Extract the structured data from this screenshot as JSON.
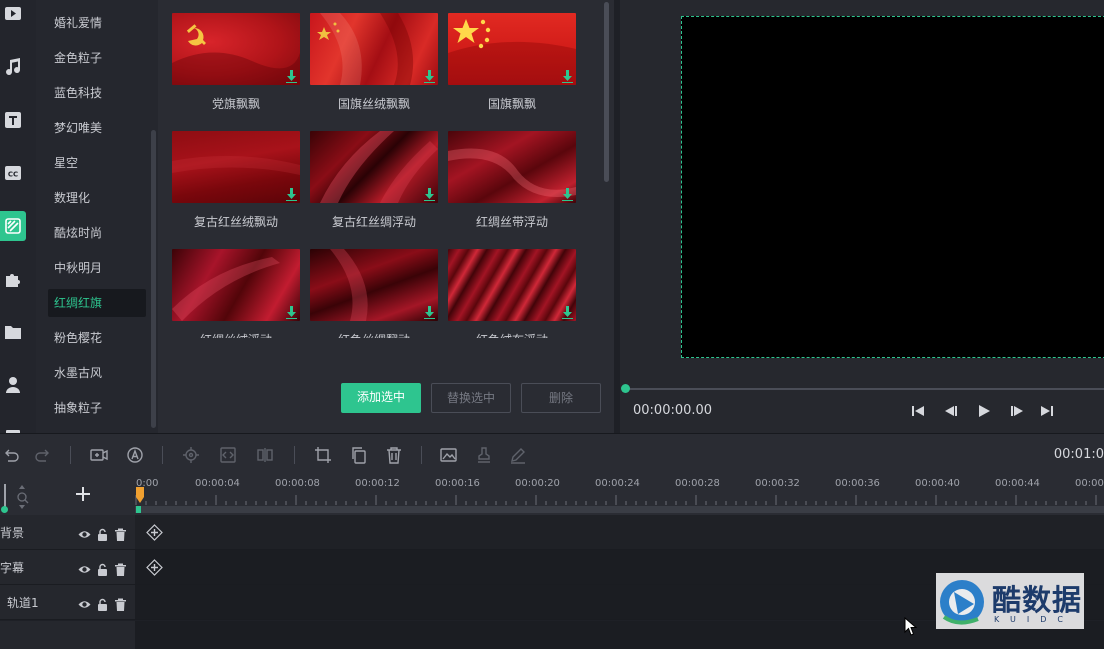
{
  "sidebar": {
    "icons": [
      "media-icon",
      "music-icon",
      "text-icon",
      "subtitle-icon",
      "effects-icon",
      "plugin-icon",
      "folder-icon",
      "person-icon",
      "more-icon"
    ],
    "active_icon": "effects-icon"
  },
  "categories": {
    "items": [
      "婚礼爱情",
      "金色粒子",
      "蓝色科技",
      "梦幻唯美",
      "星空",
      "数理化",
      "酷炫时尚",
      "中秋明月",
      "红绸红旗",
      "粉色樱花",
      "水墨古风",
      "抽象粒子"
    ],
    "selected": "红绸红旗"
  },
  "resources": {
    "items": [
      {
        "label": "党旗飘飘",
        "download_icon": "download-icon"
      },
      {
        "label": "国旗丝绒飘飘",
        "download_icon": "download-icon"
      },
      {
        "label": "国旗飘飘",
        "download_icon": "download-icon"
      },
      {
        "label": "复古红丝绒飘动",
        "download_icon": "download-icon"
      },
      {
        "label": "复古红丝绸浮动",
        "download_icon": "download-icon"
      },
      {
        "label": "红绸丝带浮动",
        "download_icon": "download-icon"
      },
      {
        "label": "红绸丝绒浮动",
        "download_icon": "download-icon"
      },
      {
        "label": "红色丝绸翻动",
        "download_icon": "download-icon"
      },
      {
        "label": "红色绒布浮动",
        "download_icon": "download-icon"
      }
    ],
    "buttons": {
      "add": "添加选中",
      "replace": "替换选中",
      "delete": "删除"
    }
  },
  "preview": {
    "timecode": "00:00:00.00",
    "controls": [
      "skip-start-icon",
      "step-back-icon",
      "play-icon",
      "step-forward-icon",
      "skip-end-icon"
    ]
  },
  "toolbar": {
    "icons": [
      "undo-icon",
      "redo-icon",
      "record-icon",
      "auto-icon",
      "locate-icon",
      "split-icon",
      "mirror-icon",
      "crop-icon",
      "copy-icon",
      "trash-icon",
      "screenshot-icon",
      "stamp-icon",
      "edit-icon"
    ],
    "total_time": "00:01:0"
  },
  "timeline": {
    "ticks": [
      "0:00",
      "00:00:04",
      "00:00:08",
      "00:00:12",
      "00:00:16",
      "00:00:20",
      "00:00:24",
      "00:00:28",
      "00:00:32",
      "00:00:36",
      "00:00:40",
      "00:00:44",
      "00:00"
    ],
    "tracks": [
      {
        "name": "背景",
        "has_add": true
      },
      {
        "name": "字幕",
        "has_add": true
      },
      {
        "name": "轨道1",
        "has_add": false
      }
    ]
  },
  "watermark": {
    "text": "酷数据",
    "sub": "KUIDC"
  },
  "colors": {
    "accent": "#2ec58f",
    "panel": "#2a2c33",
    "canvas": "#000000"
  }
}
